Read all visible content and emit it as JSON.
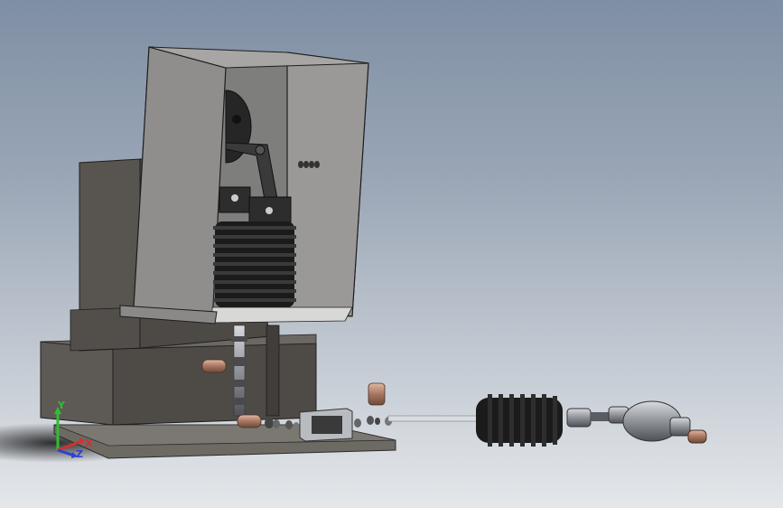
{
  "viewport": {
    "colors": {
      "background_top": "#7f8fa4",
      "background_bottom": "#e4e7ea",
      "hopper": "#8f8e8c",
      "hopper_side": "#6e6d6b",
      "frame": "#5a5854",
      "bellows": "#1f1f1f",
      "copper_fitting": "#b0836c",
      "base_plate": "#6d6a64"
    }
  },
  "triad": {
    "y_label": "Y",
    "x_label": "X",
    "z_label": "Z",
    "y_color": "#2fbf2f",
    "x_color": "#d23030",
    "z_color": "#3040d0"
  }
}
